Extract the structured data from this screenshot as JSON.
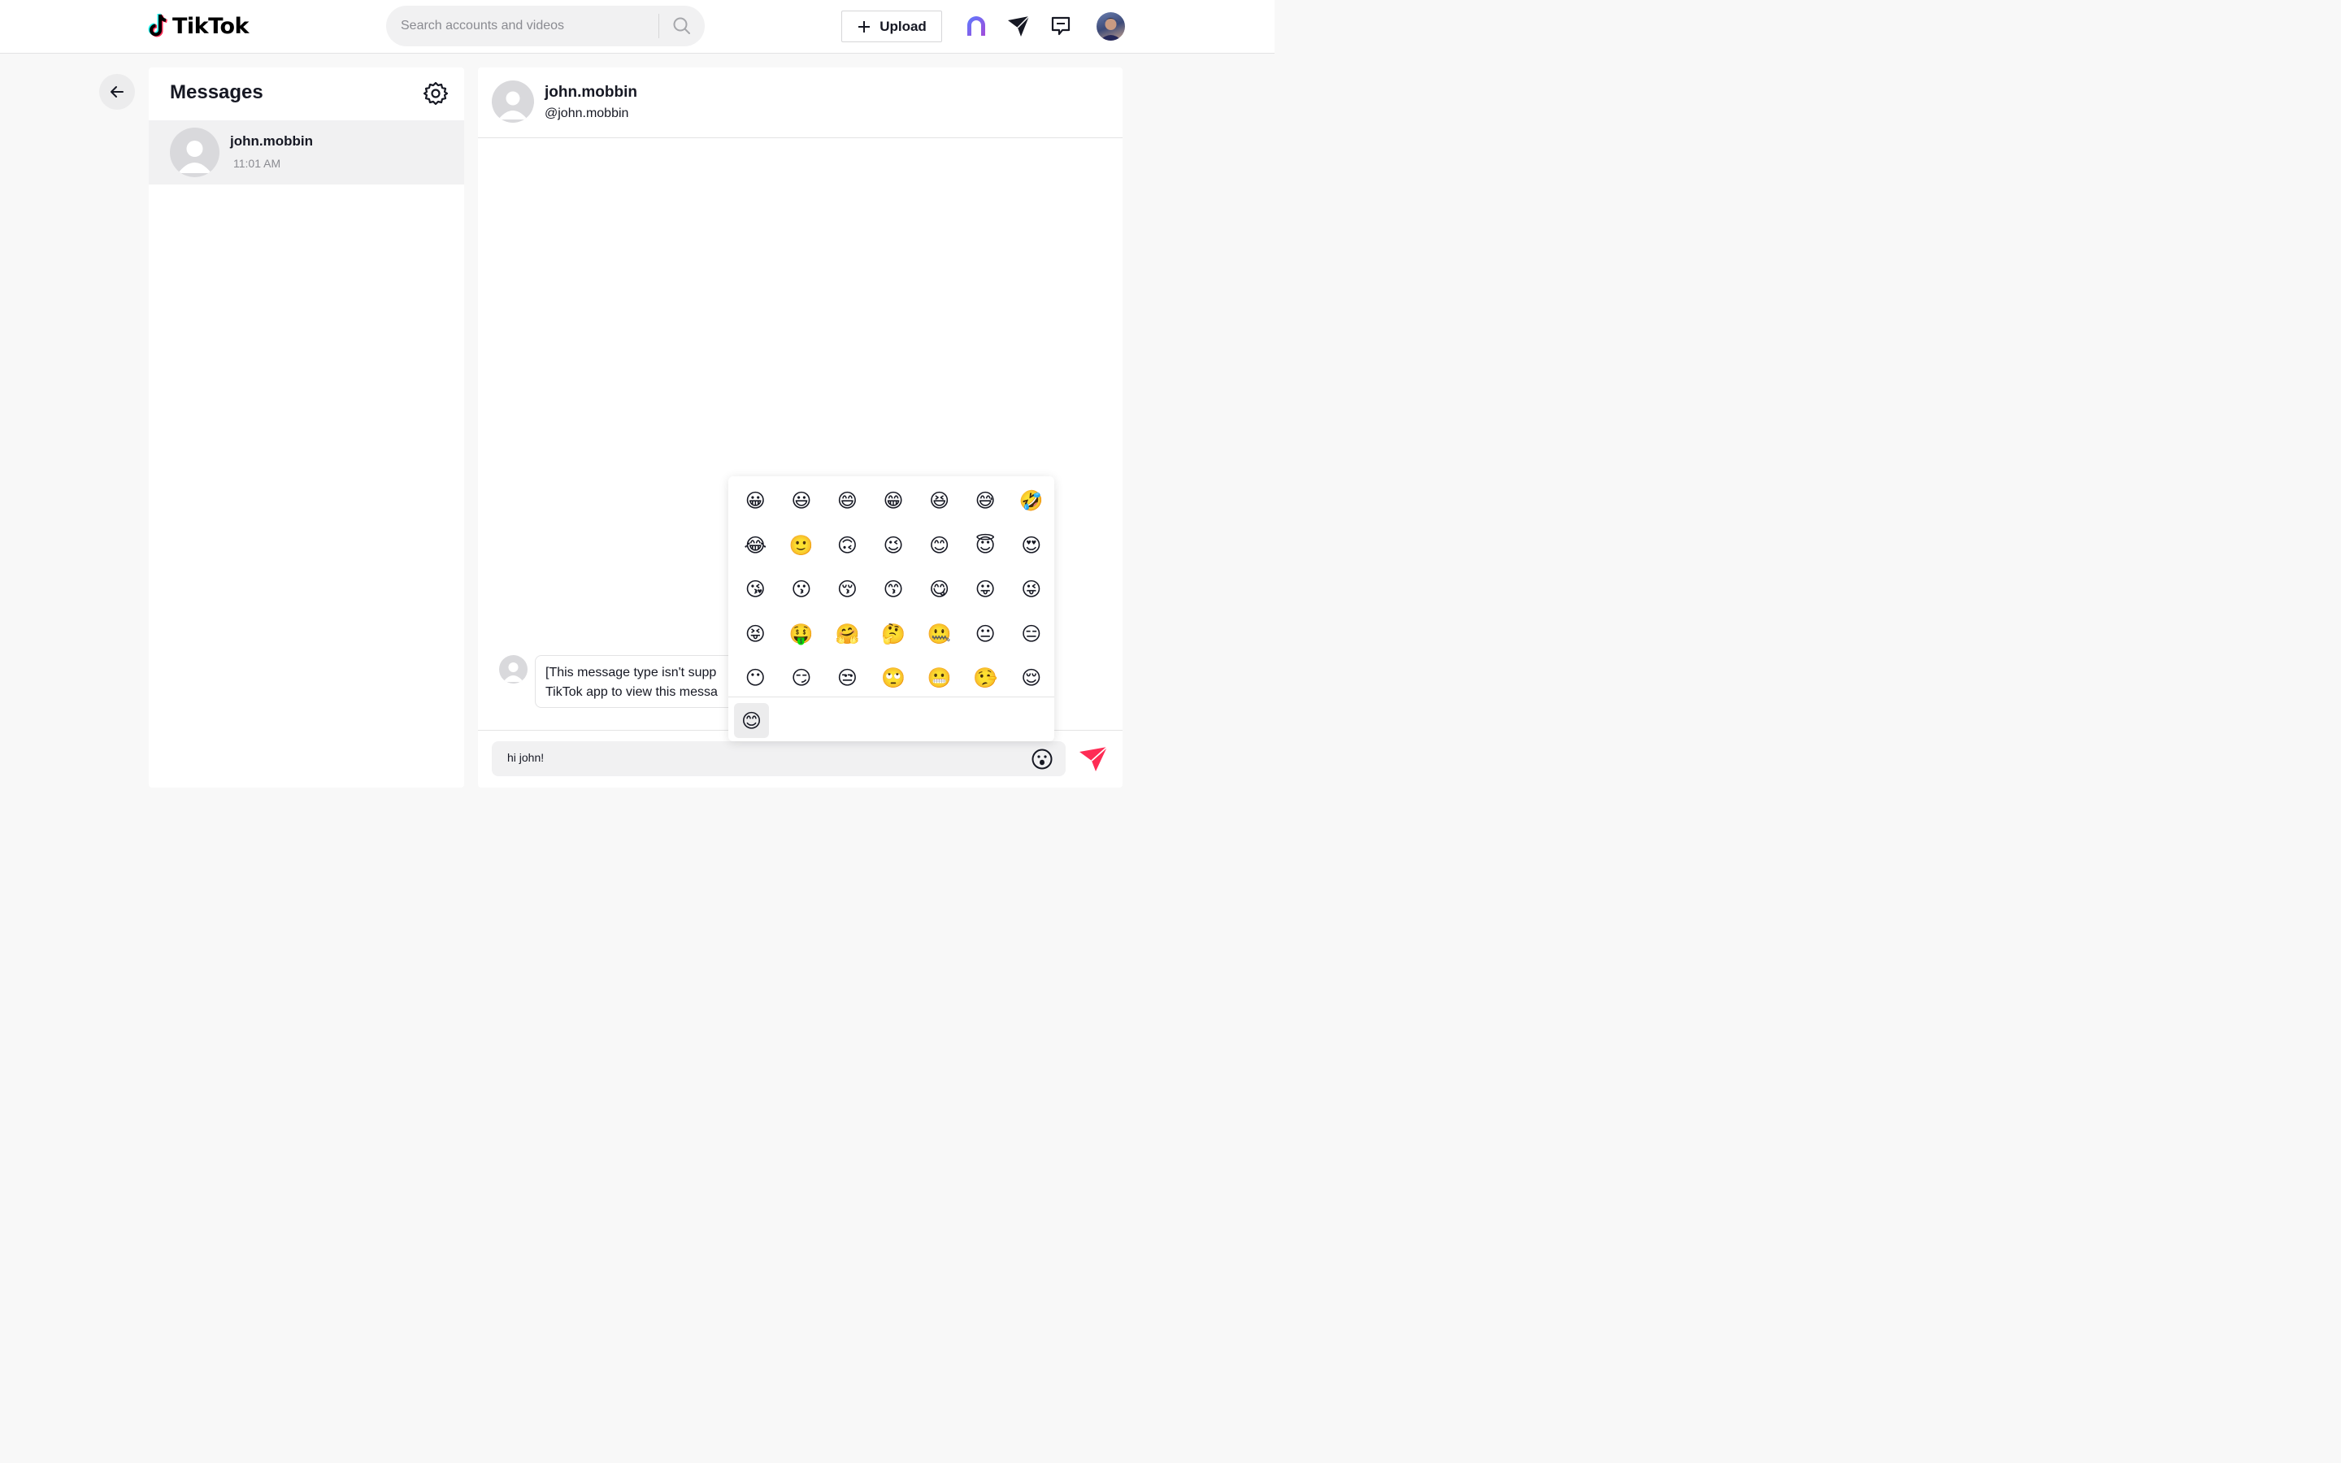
{
  "header": {
    "logo_text": "TikTok",
    "search_placeholder": "Search accounts and videos",
    "upload_label": "Upload"
  },
  "sidebar": {
    "title": "Messages",
    "conversations": [
      {
        "name": "john.mobbin",
        "time": "11:01 AM"
      }
    ]
  },
  "chat": {
    "name": "john.mobbin",
    "handle": "@john.mobbin",
    "messages": [
      {
        "line1": "[This message type isn't supp",
        "line2": "TikTok app to view this messa"
      }
    ],
    "compose_value": "hi john!"
  },
  "emoji_picker": {
    "rows": [
      [
        "😀",
        "😃",
        "😄",
        "😁",
        "😆",
        "😅",
        "🤣"
      ],
      [
        "😂",
        "🙂",
        "🙃",
        "😉",
        "😊",
        "😇",
        "😍"
      ],
      [
        "😘",
        "😗",
        "😚",
        "😙",
        "😋",
        "😛",
        "😜"
      ],
      [
        "😝",
        "🤑",
        "🤗",
        "🤔",
        "🤐",
        "😐",
        "😑"
      ],
      [
        "😶",
        "😏",
        "😒",
        "🙄",
        "😬",
        "🤥",
        "😌"
      ]
    ],
    "recent": "😊"
  },
  "colors": {
    "accent": "#fe2c55",
    "logo_cyan": "#25f4ee",
    "logo_red": "#fe2c55"
  }
}
